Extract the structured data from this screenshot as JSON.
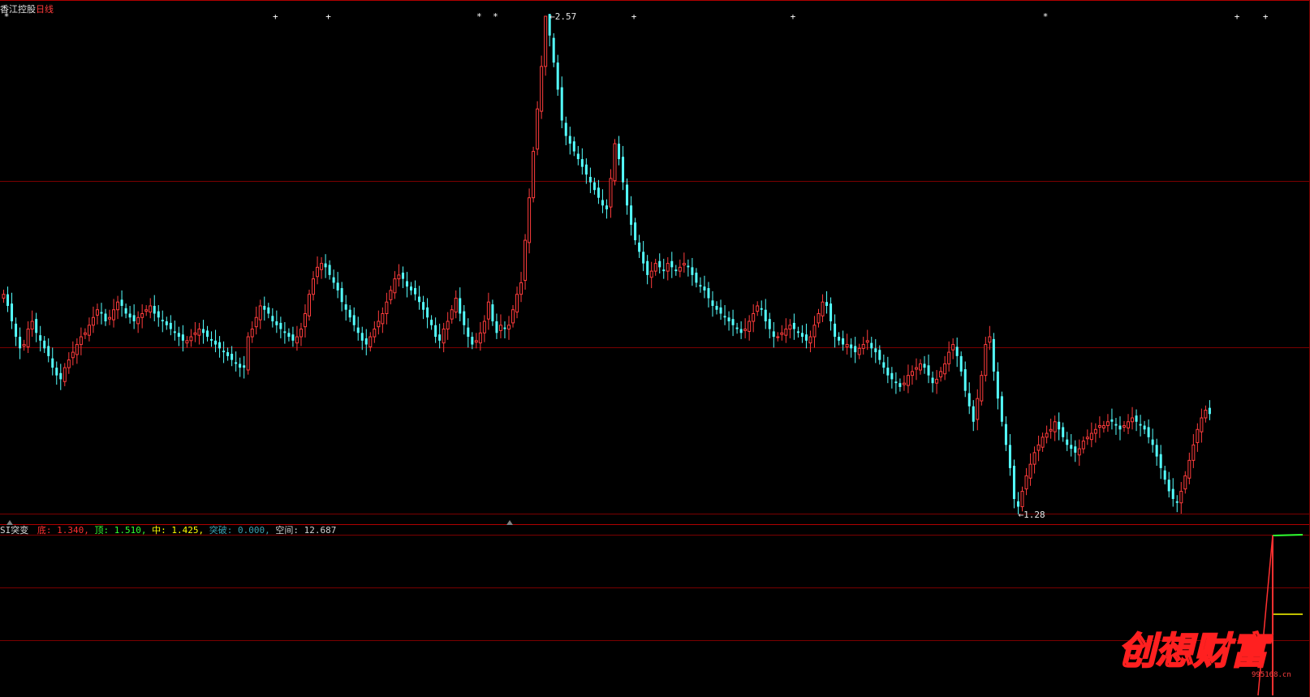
{
  "header": {
    "stock_name": "香江控股",
    "period": "日线"
  },
  "colors": {
    "up": "#ff3c3c",
    "down": "#54ffff",
    "grid": "#7a0000",
    "frame": "#b00000",
    "indicator_bottom": "#ff3030",
    "indicator_top": "#30ff30",
    "indicator_mid": "#ffff00",
    "indicator_break": "#3aa0b0",
    "indicator_space": "#d0d0d0"
  },
  "chart_data": {
    "type": "candlestick",
    "price_range": [
      1.28,
      2.57
    ],
    "high_annotation": "2.57",
    "low_annotation": "1.28",
    "signal_markers": [
      {
        "candle": 1,
        "glyph": "*"
      },
      {
        "candle": 67,
        "glyph": "+"
      },
      {
        "candle": 80,
        "glyph": "+"
      },
      {
        "candle": 117,
        "glyph": "*"
      },
      {
        "candle": 121,
        "glyph": "*"
      },
      {
        "candle": 155,
        "glyph": "+"
      },
      {
        "candle": 194,
        "glyph": "+"
      },
      {
        "candle": 256,
        "glyph": "*"
      },
      {
        "candle": 303,
        "glyph": "+"
      },
      {
        "candle": 310,
        "glyph": "+"
      }
    ],
    "series": [
      {
        "name": "close",
        "values": [
          1.85,
          1.82,
          1.78,
          1.74,
          1.71,
          1.72,
          1.76,
          1.78,
          1.75,
          1.73,
          1.71,
          1.69,
          1.66,
          1.64,
          1.63,
          1.66,
          1.68,
          1.7,
          1.72,
          1.74,
          1.75,
          1.77,
          1.79,
          1.81,
          1.8,
          1.78,
          1.79,
          1.81,
          1.83,
          1.82,
          1.8,
          1.79,
          1.78,
          1.79,
          1.8,
          1.81,
          1.82,
          1.8,
          1.79,
          1.78,
          1.77,
          1.76,
          1.75,
          1.74,
          1.73,
          1.73,
          1.74,
          1.75,
          1.76,
          1.75,
          1.74,
          1.73,
          1.72,
          1.71,
          1.7,
          1.69,
          1.68,
          1.67,
          1.66,
          1.66,
          1.74,
          1.76,
          1.79,
          1.82,
          1.81,
          1.8,
          1.78,
          1.77,
          1.76,
          1.75,
          1.74,
          1.73,
          1.74,
          1.76,
          1.8,
          1.85,
          1.89,
          1.92,
          1.93,
          1.92,
          1.9,
          1.88,
          1.86,
          1.83,
          1.81,
          1.79,
          1.77,
          1.75,
          1.73,
          1.72,
          1.74,
          1.76,
          1.78,
          1.8,
          1.83,
          1.86,
          1.89,
          1.9,
          1.89,
          1.87,
          1.86,
          1.85,
          1.83,
          1.81,
          1.79,
          1.77,
          1.74,
          1.73,
          1.76,
          1.78,
          1.81,
          1.84,
          1.8,
          1.77,
          1.74,
          1.72,
          1.73,
          1.75,
          1.78,
          1.83,
          1.78,
          1.75,
          1.77,
          1.76,
          1.77,
          1.81,
          1.85,
          1.88,
          1.99,
          2.1,
          2.22,
          2.33,
          2.44,
          2.57,
          2.52,
          2.45,
          2.38,
          2.3,
          2.26,
          2.24,
          2.22,
          2.2,
          2.18,
          2.16,
          2.14,
          2.12,
          2.1,
          2.08,
          2.07,
          2.15,
          2.24,
          2.2,
          2.14,
          2.08,
          2.03,
          1.99,
          1.96,
          1.93,
          1.9,
          1.91,
          1.93,
          1.92,
          1.91,
          1.93,
          1.92,
          1.91,
          1.92,
          1.93,
          1.92,
          1.9,
          1.88,
          1.87,
          1.86,
          1.84,
          1.82,
          1.81,
          1.8,
          1.79,
          1.78,
          1.77,
          1.76,
          1.75,
          1.76,
          1.78,
          1.8,
          1.82,
          1.81,
          1.78,
          1.76,
          1.74,
          1.74,
          1.75,
          1.76,
          1.77,
          1.76,
          1.75,
          1.74,
          1.73,
          1.74,
          1.77,
          1.8,
          1.83,
          1.82,
          1.78,
          1.74,
          1.73,
          1.72,
          1.72,
          1.71,
          1.7,
          1.71,
          1.72,
          1.73,
          1.71,
          1.7,
          1.68,
          1.66,
          1.64,
          1.63,
          1.62,
          1.61,
          1.62,
          1.64,
          1.65,
          1.66,
          1.67,
          1.66,
          1.64,
          1.62,
          1.63,
          1.65,
          1.67,
          1.7,
          1.72,
          1.69,
          1.65,
          1.6,
          1.56,
          1.52,
          1.58,
          1.64,
          1.72,
          1.74,
          1.65,
          1.58,
          1.52,
          1.46,
          1.4,
          1.32,
          1.3,
          1.34,
          1.38,
          1.41,
          1.44,
          1.46,
          1.48,
          1.49,
          1.5,
          1.52,
          1.5,
          1.48,
          1.46,
          1.45,
          1.44,
          1.45,
          1.47,
          1.48,
          1.49,
          1.5,
          1.51,
          1.51,
          1.52,
          1.52,
          1.51,
          1.5,
          1.51,
          1.52,
          1.53,
          1.52,
          1.51,
          1.5,
          1.48,
          1.46,
          1.43,
          1.4,
          1.37,
          1.34,
          1.32,
          1.31,
          1.34,
          1.38,
          1.42,
          1.46,
          1.5,
          1.53,
          1.55,
          1.54
        ]
      }
    ]
  },
  "indicator": {
    "name": "SI突变",
    "bottom_label": "底",
    "bottom_value": "1.340",
    "top_label": "顶",
    "top_value": "1.510",
    "mid_label": "中",
    "mid_value": "1.425",
    "break_label": "突破",
    "break_value": "0.000",
    "space_label": "空间",
    "space_value": "12.687"
  },
  "watermark": {
    "text": "创想财富",
    "site": "995168.cn"
  }
}
